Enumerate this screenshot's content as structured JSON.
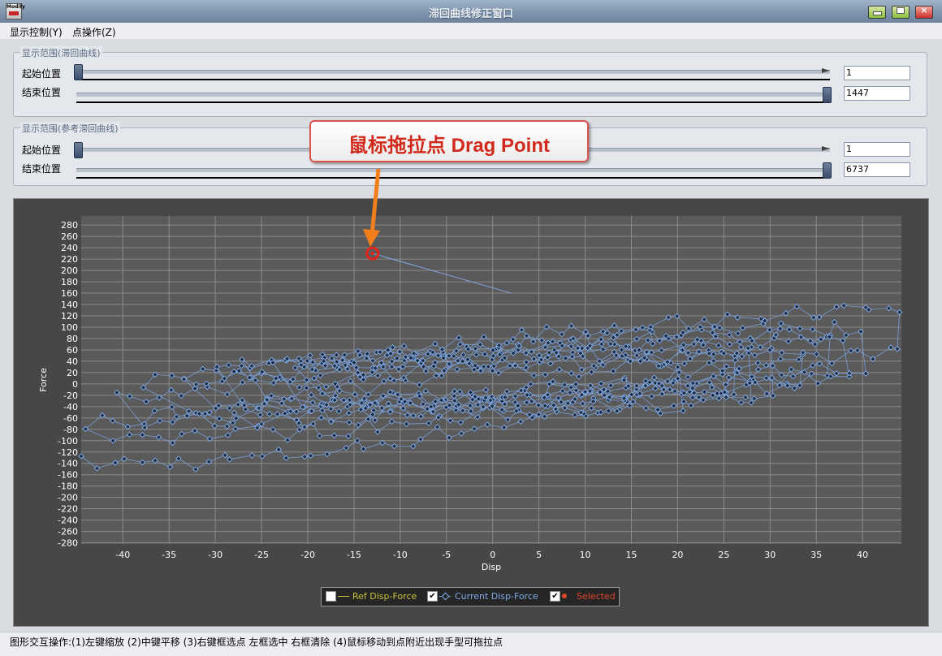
{
  "window": {
    "title": "滞回曲线修正窗口",
    "app_icon_text": "Modify"
  },
  "menu": [
    {
      "label": "显示控制(Y)"
    },
    {
      "label": "点操作(Z)"
    }
  ],
  "range_groups": [
    {
      "title": "显示范围(滞回曲线)",
      "start_label": "起始位置",
      "end_label": "结束位置",
      "start_value": "1",
      "end_value": "1447",
      "start_fraction": 0,
      "end_fraction": 1
    },
    {
      "title": "显示范围(参考滞回曲线)",
      "start_label": "起始位置",
      "end_label": "结束位置",
      "start_value": "1",
      "end_value": "6737",
      "start_fraction": 0,
      "end_fraction": 1
    }
  ],
  "callout": {
    "text": "鼠标拖拉点  Drag Point",
    "color": "#d12a1c"
  },
  "chart_data": {
    "type": "scatter",
    "xlabel": "Disp",
    "ylabel": "Force",
    "xlim": [
      -44.5,
      44.2
    ],
    "ylim": [
      -282,
      296
    ],
    "x_ticks": [
      -40,
      -35,
      -30,
      -25,
      -20,
      -15,
      -10,
      -5,
      0,
      5,
      10,
      15,
      20,
      25,
      30,
      35,
      40
    ],
    "y_ticks": [
      280,
      260,
      240,
      220,
      200,
      180,
      160,
      140,
      120,
      100,
      80,
      60,
      40,
      20,
      0,
      -20,
      -40,
      -60,
      -80,
      -100,
      -120,
      -140,
      -160,
      -180,
      -200,
      -220,
      -240,
      -260,
      -280
    ],
    "grid": true,
    "series_color": "#7fa8e6",
    "selected_point": {
      "x": -13,
      "y": 230
    },
    "drag_link_point": {
      "x": 2,
      "y": 160
    },
    "legend": [
      {
        "label": "Ref Disp-Force",
        "checked": false,
        "color": "#c9c23b"
      },
      {
        "label": "Current Disp-Force",
        "checked": true,
        "color": "#7fa8e6"
      },
      {
        "label": "Selected",
        "checked": true,
        "color": "#e0452c"
      }
    ],
    "loops": [
      [
        -44,
        -105,
        20,
        -4
      ],
      [
        -41,
        -55,
        26,
        10
      ],
      [
        -38,
        -30,
        28,
        8
      ],
      [
        -33,
        -20,
        30,
        20
      ],
      [
        -30,
        -5,
        33,
        30
      ],
      [
        -27,
        -5,
        36,
        40
      ],
      [
        -24,
        0,
        38,
        50
      ],
      [
        -21,
        5,
        40,
        60
      ],
      [
        -18,
        10,
        44,
        90
      ]
    ],
    "check_mark": "✔"
  },
  "status": {
    "text": "图形交互操作:(1)左键缩放 (2)中键平移 (3)右键框选点 左框选中 右框清除 (4)鼠标移动到点附近出现手型可拖拉点"
  }
}
